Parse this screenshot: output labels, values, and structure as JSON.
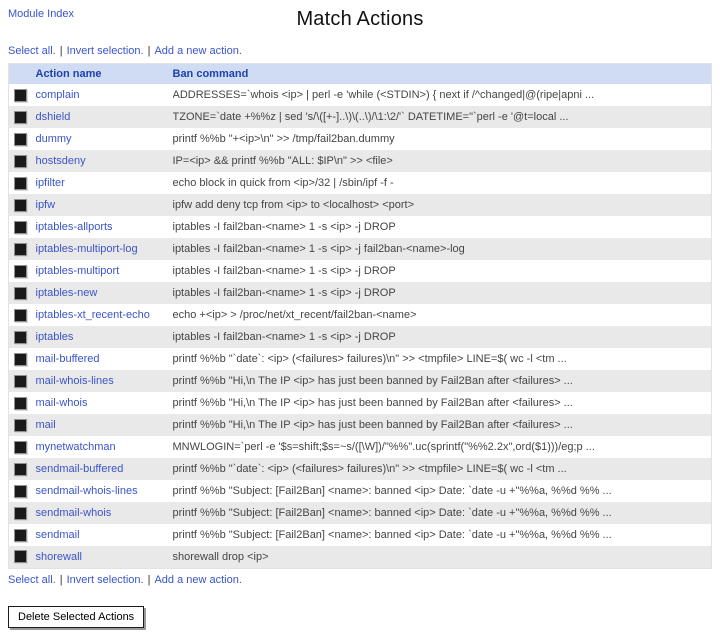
{
  "page": {
    "module_index_label": "Module Index",
    "title": "Match Actions"
  },
  "links": {
    "select_all": "Select all.",
    "invert_selection": "Invert selection.",
    "add_new_action": "Add a new action.",
    "separator": "|"
  },
  "table": {
    "headers": {
      "action_name": "Action name",
      "ban_command": "Ban command"
    },
    "rows": [
      {
        "name": "complain",
        "command": "ADDRESSES=`whois <ip> | perl -e 'while (<STDIN>) { next if /^changed|@(ripe|apni ..."
      },
      {
        "name": "dshield",
        "command": "TZONE=`date +%%z | sed 's/\\([+-]..\\)\\(..\\)/\\1:\\2/'` DATETIME=\"`perl -e '@t=local ..."
      },
      {
        "name": "dummy",
        "command": "printf %%b \"+<ip>\\n\" >> /tmp/fail2ban.dummy"
      },
      {
        "name": "hostsdeny",
        "command": "IP=<ip> && printf %%b \"ALL: $IP\\n\" >> <file>"
      },
      {
        "name": "ipfilter",
        "command": "echo block in quick from <ip>/32 | /sbin/ipf -f -"
      },
      {
        "name": "ipfw",
        "command": "ipfw add deny tcp from <ip> to <localhost> <port>"
      },
      {
        "name": "iptables-allports",
        "command": "iptables -I fail2ban-<name> 1 -s <ip> -j DROP"
      },
      {
        "name": "iptables-multiport-log",
        "command": "iptables -I fail2ban-<name> 1 -s <ip> -j fail2ban-<name>-log"
      },
      {
        "name": "iptables-multiport",
        "command": "iptables -I fail2ban-<name> 1 -s <ip> -j DROP"
      },
      {
        "name": "iptables-new",
        "command": "iptables -I fail2ban-<name> 1 -s <ip> -j DROP"
      },
      {
        "name": "iptables-xt_recent-echo",
        "command": "echo +<ip> > /proc/net/xt_recent/fail2ban-<name>"
      },
      {
        "name": "iptables",
        "command": "iptables -I fail2ban-<name> 1 -s <ip> -j DROP"
      },
      {
        "name": "mail-buffered",
        "command": "printf %%b \"`date`: <ip> (<failures> failures)\\n\" >> <tmpfile> LINE=$( wc -l <tm ..."
      },
      {
        "name": "mail-whois-lines",
        "command": "printf %%b \"Hi,\\n The IP <ip> has just been banned by Fail2Ban after <failures> ..."
      },
      {
        "name": "mail-whois",
        "command": "printf %%b \"Hi,\\n The IP <ip> has just been banned by Fail2Ban after <failures> ..."
      },
      {
        "name": "mail",
        "command": "printf %%b \"Hi,\\n The IP <ip> has just been banned by Fail2Ban after <failures> ..."
      },
      {
        "name": "mynetwatchman",
        "command": "MNWLOGIN=`perl -e '$s=shift;$s=~s/([\\W])/\"%%\".uc(sprintf(\"%%2.2x\",ord($1)))/eg;p ..."
      },
      {
        "name": "sendmail-buffered",
        "command": "printf %%b \"`date`: <ip> (<failures> failures)\\n\" >> <tmpfile> LINE=$( wc -l <tm ..."
      },
      {
        "name": "sendmail-whois-lines",
        "command": "printf %%b \"Subject: [Fail2Ban] <name>: banned <ip> Date: `date -u +\"%%a, %%d %% ..."
      },
      {
        "name": "sendmail-whois",
        "command": "printf %%b \"Subject: [Fail2Ban] <name>: banned <ip> Date: `date -u +\"%%a, %%d %% ..."
      },
      {
        "name": "sendmail",
        "command": "printf %%b \"Subject: [Fail2Ban] <name>: banned <ip> Date: `date -u +\"%%a, %%d %% ..."
      },
      {
        "name": "shorewall",
        "command": "shorewall drop <ip>"
      }
    ]
  },
  "footer": {
    "delete_button_label": "Delete Selected Actions"
  },
  "colors": {
    "link_blue": "#3a55c8",
    "header_bg": "#cfdcf4",
    "header_text": "#2041ad",
    "stripe_gray": "#e9e9e9"
  }
}
